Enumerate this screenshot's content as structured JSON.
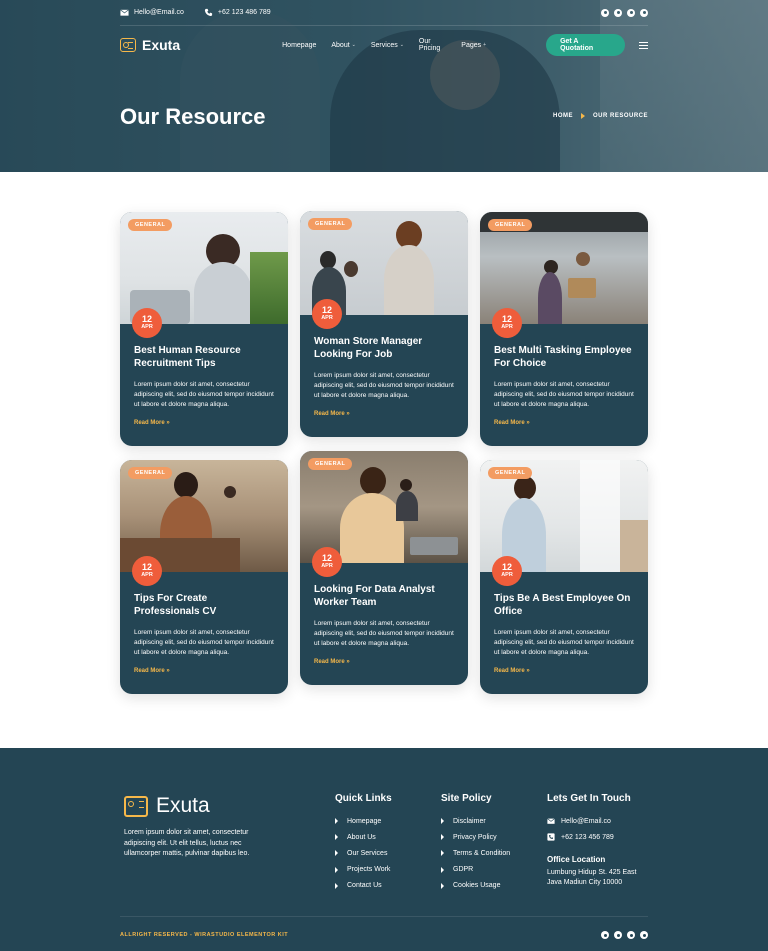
{
  "topbar": {
    "email": "Hello@Email.co",
    "phone": "+62 123 486 789",
    "social_icons": [
      "facebook-icon",
      "twitter-icon",
      "youtube-icon",
      "pinterest-icon"
    ]
  },
  "brand": {
    "name": "Exuta"
  },
  "nav": {
    "items": [
      {
        "label": "Homepage",
        "has_caret": false
      },
      {
        "label": "About",
        "has_caret": true
      },
      {
        "label": "Services",
        "has_caret": true
      },
      {
        "label": "Our Pricing",
        "has_caret": false
      },
      {
        "label": "Pages",
        "has_caret": true
      }
    ],
    "cta": "Get A Quotation"
  },
  "hero": {
    "title": "Our Resource",
    "breadcrumb": [
      "HOME",
      "OUR RESOURCE"
    ]
  },
  "cards": [
    {
      "tag": "GENERAL",
      "day": "12",
      "month": "APR",
      "title": "Best Human Resource Recruitment Tips",
      "text": "Lorem ipsum dolor sit amet, consectetur adipiscing elit, sed do eiusmod tempor incididunt ut labore et dolore magna aliqua.",
      "link": "Read More »"
    },
    {
      "tag": "GENERAL",
      "day": "12",
      "month": "APR",
      "title": "Woman Store Manager Looking For Job",
      "text": "Lorem ipsum dolor sit amet, consectetur adipiscing elit, sed do eiusmod tempor incididunt ut labore et dolore magna aliqua.",
      "link": "Read More »"
    },
    {
      "tag": "GENERAL",
      "day": "12",
      "month": "APR",
      "title": "Best Multi Tasking Employee For Choice",
      "text": "Lorem ipsum dolor sit amet, consectetur adipiscing elit, sed do eiusmod tempor incididunt ut labore et dolore magna aliqua.",
      "link": "Read More »"
    },
    {
      "tag": "GENERAL",
      "day": "12",
      "month": "APR",
      "title": "Tips For Create Professionals CV",
      "text": "Lorem ipsum dolor sit amet, consectetur adipiscing elit, sed do eiusmod tempor incididunt ut labore et dolore magna aliqua.",
      "link": "Read More »"
    },
    {
      "tag": "GENERAL",
      "day": "12",
      "month": "APR",
      "title": "Looking For Data Analyst Worker Team",
      "text": "Lorem ipsum dolor sit amet, consectetur adipiscing elit, sed do eiusmod tempor incididunt ut labore et dolore magna aliqua.",
      "link": "Read More »"
    },
    {
      "tag": "GENERAL",
      "day": "12",
      "month": "APR",
      "title": "Tips Be A Best Employee On Office",
      "text": "Lorem ipsum dolor sit amet, consectetur adipiscing elit, sed do eiusmod tempor incididunt ut labore et dolore magna aliqua.",
      "link": "Read More »"
    }
  ],
  "footer": {
    "brand": "Exuta",
    "description": "Lorem ipsum dolor sit amet, consectetur adipiscing elit. Ut elit tellus, luctus nec ullamcorper mattis, pulvinar dapibus leo.",
    "quick_links": {
      "title": "Quick Links",
      "items": [
        "Homepage",
        "About Us",
        "Our Services",
        "Projects Work",
        "Contact Us"
      ]
    },
    "site_policy": {
      "title": "Site Policy",
      "items": [
        "Disclaimer",
        "Privacy Policy",
        "Terms & Condition",
        "GDPR",
        "Cookies Usage"
      ]
    },
    "contact": {
      "title": "Lets Get In Touch",
      "email": "Hello@Email.co",
      "phone": "+62 123 456 789",
      "office_title": "Office Location",
      "office_address": "Lumbung Hidup St. 425 East Java Madiun City 10000"
    },
    "copyright": "ALLRIGHT RESERVED - WIRASTUDIO ELEMENTOR KIT",
    "social_icons": [
      "facebook-icon",
      "twitter-icon",
      "youtube-icon",
      "pinterest-icon"
    ]
  },
  "colors": {
    "primary": "#244554",
    "accent": "#f6b84a",
    "cta": "#28a78b",
    "tag": "#f39c62",
    "date_badge": "#ef5d3b"
  }
}
